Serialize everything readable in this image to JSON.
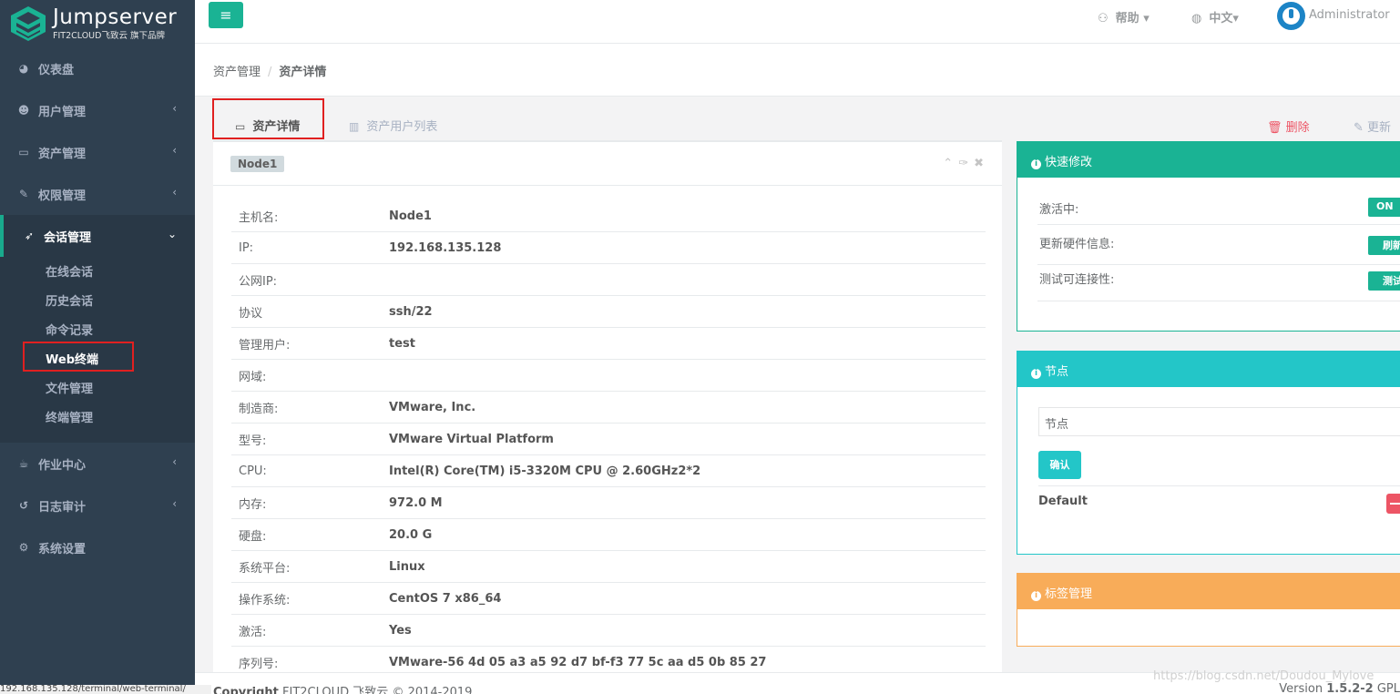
{
  "brand": {
    "title": "Jumpserver",
    "subtitle": "FIT2CLOUD飞致云 旗下品牌"
  },
  "sidebar": {
    "items": [
      {
        "label": "仪表盘",
        "icon": "dashboard-icon"
      },
      {
        "label": "用户管理",
        "icon": "users-icon"
      },
      {
        "label": "资产管理",
        "icon": "inbox-icon"
      },
      {
        "label": "权限管理",
        "icon": "edit-icon"
      },
      {
        "label": "会话管理",
        "icon": "rocket-icon"
      },
      {
        "label": "作业中心",
        "icon": "coffee-icon"
      },
      {
        "label": "日志审计",
        "icon": "history-icon"
      },
      {
        "label": "系统设置",
        "icon": "gears-icon"
      }
    ],
    "sub_items": [
      "在线会话",
      "历史会话",
      "命令记录",
      "Web终端",
      "文件管理",
      "终端管理"
    ]
  },
  "topbar": {
    "help": "帮助",
    "lang": "中文",
    "user": "Administrator"
  },
  "breadcrumb": {
    "parent": "资产管理",
    "sep": "/",
    "current": "资产详情"
  },
  "tabs": {
    "detail": "资产详情",
    "users": "资产用户列表"
  },
  "actions": {
    "delete": "删除",
    "update": "更新"
  },
  "asset": {
    "badge": "Node1",
    "rows": [
      {
        "k": "主机名:",
        "v": "Node1"
      },
      {
        "k": "IP:",
        "v": "192.168.135.128"
      },
      {
        "k": "公网IP:",
        "v": ""
      },
      {
        "k": "协议",
        "v": "ssh/22"
      },
      {
        "k": "管理用户:",
        "v": "test"
      },
      {
        "k": "网域:",
        "v": ""
      },
      {
        "k": "制造商:",
        "v": "VMware, Inc."
      },
      {
        "k": "型号:",
        "v": "VMware Virtual Platform"
      },
      {
        "k": "CPU:",
        "v": "Intel(R) Core(TM) i5-3320M CPU @ 2.60GHz2*2"
      },
      {
        "k": "内存:",
        "v": "972.0 M"
      },
      {
        "k": "硬盘:",
        "v": "20.0 G"
      },
      {
        "k": "系统平台:",
        "v": "Linux"
      },
      {
        "k": "操作系统:",
        "v": "CentOS 7 x86_64"
      },
      {
        "k": "激活:",
        "v": "Yes"
      },
      {
        "k": "序列号:",
        "v": "VMware-56 4d 05 a3 a5 92 d7 bf-f3 77 5c aa d5 0b 85 27"
      }
    ]
  },
  "quick": {
    "title": "快速修改",
    "active_label": "激活中:",
    "toggle": "ON",
    "hw_label": "更新硬件信息:",
    "hw_btn": "刷新",
    "conn_label": "测试可连接性:",
    "conn_btn": "测试"
  },
  "nodes": {
    "title": "节点",
    "placeholder": "节点",
    "confirm": "确认",
    "default": "Default"
  },
  "labels": {
    "title": "标签管理"
  },
  "footer": {
    "copy_bold": "Copyright",
    "copy_rest": " FIT2CLOUD 飞致云 © 2014-2019",
    "version_prefix": "Version ",
    "version": "1.5.2-2",
    "version_suffix": " GPL"
  },
  "watermark": "https://blog.csdn.net/Doudou_Mylove",
  "status_url": "192.168.135.128/terminal/web-terminal/"
}
